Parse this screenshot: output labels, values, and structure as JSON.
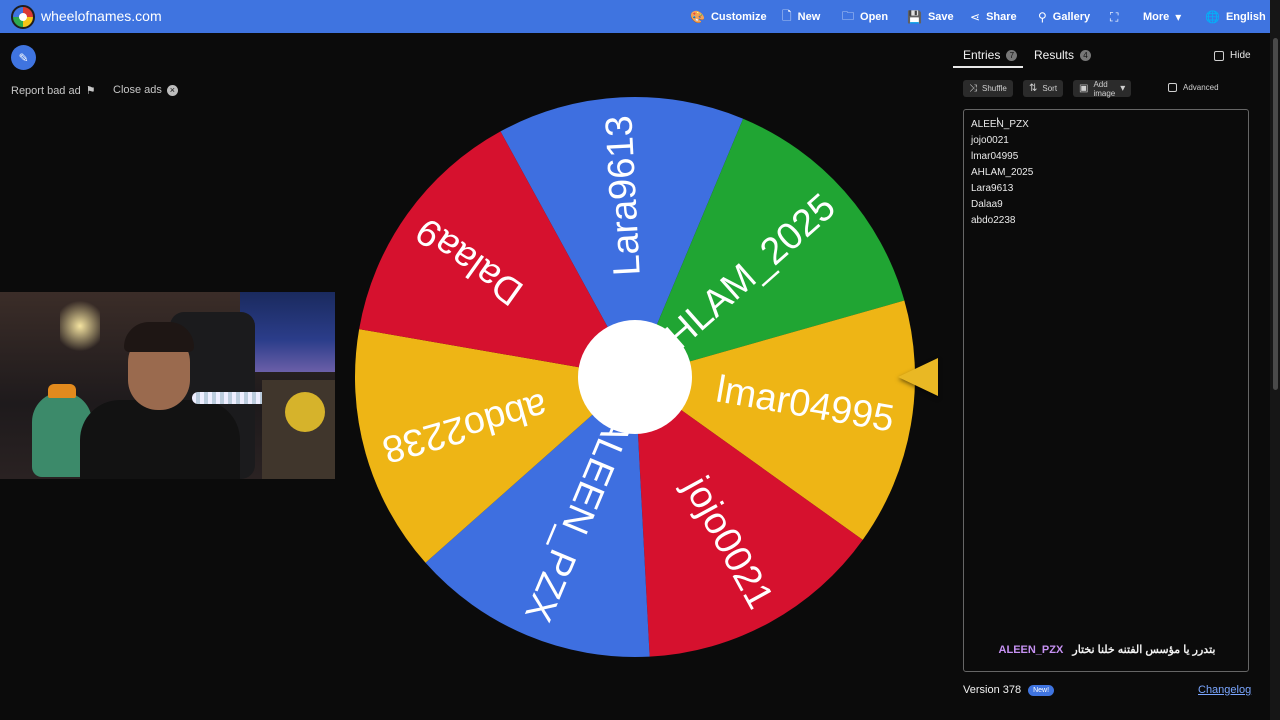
{
  "header": {
    "brand": "wheelofnames.com",
    "nav": [
      {
        "icon": "palette-icon",
        "glyph": "🎨",
        "label": "Customize"
      },
      {
        "icon": "file-icon",
        "glyph": "🗋",
        "label": "New"
      },
      {
        "icon": "folder-icon",
        "glyph": "🗀",
        "label": "Open"
      },
      {
        "icon": "save-icon",
        "glyph": "💾",
        "label": "Save"
      },
      {
        "icon": "share-icon",
        "glyph": "⋖",
        "label": "Share"
      },
      {
        "icon": "search-icon",
        "glyph": "⚲",
        "label": "Gallery"
      },
      {
        "icon": "fullscreen-icon",
        "glyph": "⛶",
        "label": ""
      },
      {
        "icon": "chevron-down-icon",
        "glyph": "▾",
        "label": "More"
      },
      {
        "icon": "globe-icon",
        "glyph": "🌐",
        "label": "English"
      }
    ]
  },
  "left": {
    "report_ad": "Report bad ad",
    "close_ads": "Close ads"
  },
  "wheel": {
    "slices": [
      {
        "label": "Lara9613",
        "color": "#3e6fe0"
      },
      {
        "label": "AHLAM_2025",
        "color": "#20a533"
      },
      {
        "label": "lmar04995",
        "color": "#eeb515"
      },
      {
        "label": "jojo0021",
        "color": "#d6112e"
      },
      {
        "label": "ALEEN_PZX",
        "color": "#3e6fe0"
      },
      {
        "label": "abdo2238",
        "color": "#eeb515"
      },
      {
        "label": "Dalaa9",
        "color": "#d6112e"
      }
    ],
    "pointer_color": "#e9b824"
  },
  "panel": {
    "tabs": {
      "entries_label": "Entries",
      "entries_count": "7",
      "results_label": "Results",
      "results_count": "4"
    },
    "hide_label": "Hide",
    "toolbar": {
      "shuffle": "Shuffle",
      "sort": "Sort",
      "add_image": "Add image",
      "advanced": "Advanced"
    },
    "entries": [
      "ALEEN_PZX",
      "jojo0021",
      "lmar04995",
      "AHLAM_2025",
      "Lara9613",
      "Dalaa9",
      "abdo2238"
    ],
    "winner_text": "بتدرر يا مؤسس الفتنه خلنا نختار",
    "winner_name": "ALEEN_PZX",
    "version": "Version 378",
    "new_badge": "New!",
    "changelog": "Changelog"
  }
}
